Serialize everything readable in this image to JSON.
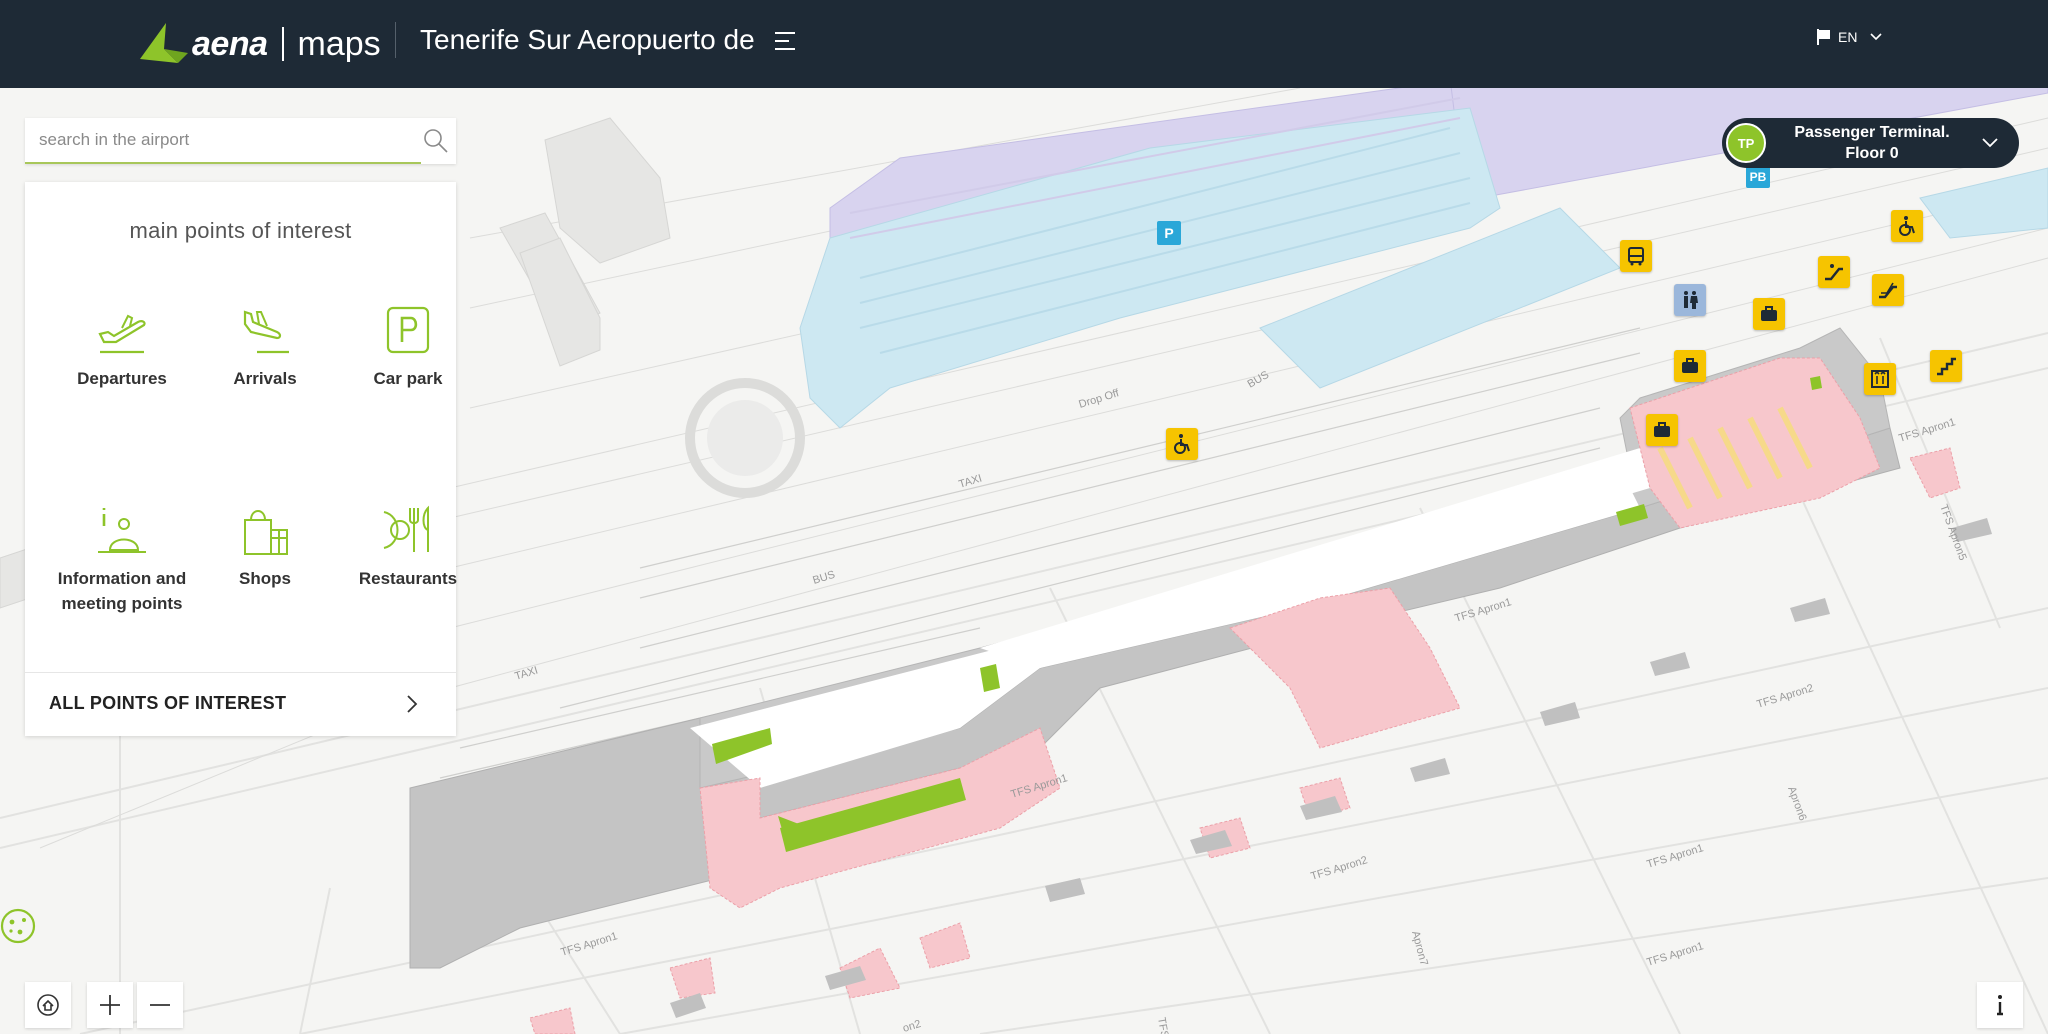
{
  "header": {
    "brand_name": "aena",
    "brand_product": "maps",
    "airport_title": "Tenerife Sur Aeropuerto de",
    "language": "EN"
  },
  "search": {
    "placeholder": "search in the airport"
  },
  "poi_panel": {
    "title": "main points of interest",
    "items": [
      {
        "label": "Departures",
        "icon": "departures-icon"
      },
      {
        "label": "Arrivals",
        "icon": "arrivals-icon"
      },
      {
        "label": "Car park",
        "icon": "car-park-icon"
      },
      {
        "label": "Information and meeting points",
        "icon": "information-icon"
      },
      {
        "label": "Shops",
        "icon": "shops-icon"
      },
      {
        "label": "Restaurants",
        "icon": "restaurants-icon"
      }
    ],
    "all_link": "ALL POINTS OF INTEREST"
  },
  "floor_selector": {
    "badge": "TP",
    "line1": "Passenger Terminal.",
    "line2": "Floor 0"
  },
  "map": {
    "parking_badge": "P",
    "pb_badge": "PB",
    "road_labels": [
      "Drop Off",
      "BUS",
      "TAXI",
      "BUS",
      "TAXI",
      "TFS Apron1",
      "TFS Apron1",
      "TFS Apron1",
      "TFS Apron1",
      "TFS Apron1",
      "TFS Apron2",
      "TFS Apron2",
      "TFS Apron5",
      "Apron6",
      "Apron7",
      "TFS Apron1",
      "TFS",
      "on2"
    ],
    "markers": [
      "bus-stop-icon",
      "toilets-icon",
      "baggage-icon",
      "escalator-icon",
      "escalator-icon",
      "accessibility-icon",
      "accessibility-icon",
      "baggage-icon",
      "baggage-icon",
      "baggage-icon",
      "lift-icon",
      "stairs-icon"
    ]
  },
  "colors": {
    "header_bg": "#1e2a36",
    "accent": "#8ec42a",
    "poi_yellow": "#f6c400",
    "terminal_gray": "#c4c4c4",
    "pink_zone": "#f7c7cc",
    "parking_blue": "#cde8f2",
    "parking_purple": "#d8d3ef"
  }
}
